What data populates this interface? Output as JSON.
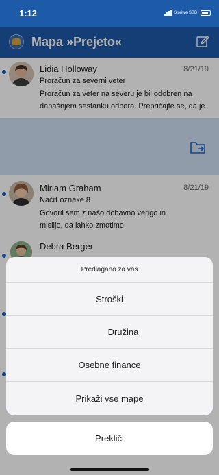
{
  "status_bar": {
    "time": "1:12",
    "carrier": "Storitve SBB"
  },
  "header": {
    "title": "Mapa »Prejeto«",
    "compose_icon": "compose-icon"
  },
  "mails": [
    {
      "sender": "Lidia Holloway",
      "date": "8/21/19",
      "subject": "Proračun za severni veter",
      "preview": "Proračun za veter na severu je bil odobren na današnjem sestanku odbora. Prepričajte se, da je",
      "unread": true
    },
    {
      "sender": "Miriam Graham",
      "date": "8/21/19",
      "subject": "Načrt oznake 8",
      "preview": "Govoril sem z našo dobavno verigo in mislijo, da lahko zmotimo.",
      "unread": true
    },
    {
      "sender": "Debra Berger",
      "date": "",
      "subject": "",
      "preview": "",
      "unread": true
    }
  ],
  "swipe_action": {
    "icon": "move-to-folder-icon"
  },
  "sheet": {
    "header": "Predlagano za vas",
    "items": [
      "Stroški",
      "Družina",
      "Osebne finance",
      "Prikaži vse mape"
    ],
    "cancel": "Prekliči"
  },
  "colors": {
    "brand": "#1d5aa8",
    "unread_dot": "#1f62c1",
    "swipe_bg": "#cfe0f4"
  }
}
